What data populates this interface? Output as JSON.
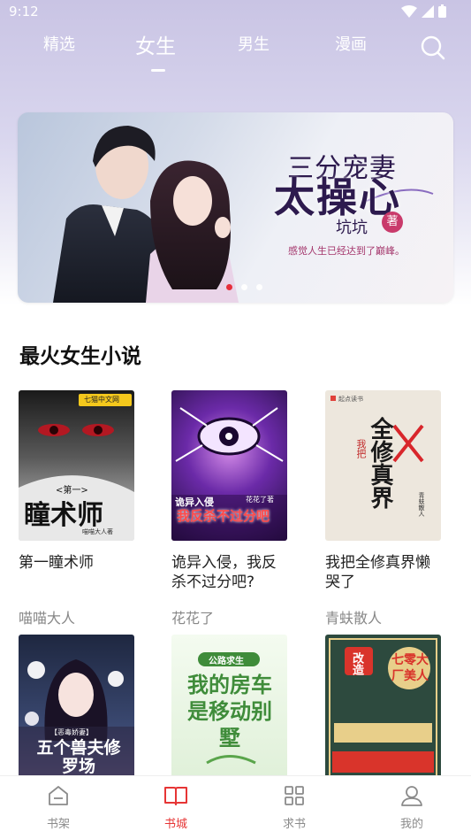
{
  "status_bar": {
    "time": "9:12"
  },
  "tabs": [
    {
      "label": "精选",
      "active": false
    },
    {
      "label": "女生",
      "active": true
    },
    {
      "label": "男生",
      "active": false
    },
    {
      "label": "漫画",
      "active": false
    }
  ],
  "banner": {
    "title_line1": "三分宠妻",
    "title_line2": "太操心",
    "author": "坑坑",
    "author_badge": "著",
    "tagline": "感觉人生已经达到了巅峰。",
    "slide_count": 3,
    "active_slide": 1
  },
  "section": {
    "title": "最火女生小说"
  },
  "books": [
    {
      "title": "第一瞳术师",
      "author": "喵喵大人",
      "cover_text": "瞳术师",
      "cover_sub": "<第一>",
      "cover_author": "喵喵大人著",
      "publisher": "七猫中文网",
      "cover_palette": "#3a3a3a"
    },
    {
      "title": "诡异入侵，我反杀不过分吧?",
      "author": "花花了",
      "cover_text": "我反杀不过分吧",
      "cover_sub": "诡异入侵",
      "cover_author": "花花了著",
      "publisher": "",
      "cover_palette": "#4a1f6e"
    },
    {
      "title": "我把全修真界懒哭了",
      "author": "青蚨散人",
      "cover_text": "全修真界",
      "cover_sub": "我把",
      "cover_author": "青蚨散人",
      "publisher": "起点读书",
      "cover_palette": "#ede7dd"
    },
    {
      "title": "",
      "author": "",
      "cover_text": "五个兽夫修罗场",
      "cover_sub": "【恶毒娇妻】",
      "cover_author": "",
      "publisher": "",
      "cover_palette": "#2f3b5c"
    },
    {
      "title": "",
      "author": "",
      "cover_text": "我的房车是移动别墅",
      "cover_sub": "公路求生",
      "cover_author": "",
      "publisher": "",
      "cover_palette": "#dff0d8"
    },
    {
      "title": "",
      "author": "",
      "cover_text": "七零大厂美人",
      "cover_sub": "改造",
      "cover_author": "",
      "publisher": "",
      "cover_palette": "#2d4a3e"
    }
  ],
  "bottom_nav": [
    {
      "label": "书架",
      "icon": "bookshelf-icon",
      "active": false
    },
    {
      "label": "书城",
      "icon": "book-open-icon",
      "active": true
    },
    {
      "label": "求书",
      "icon": "grid-icon",
      "active": false
    },
    {
      "label": "我的",
      "icon": "user-icon",
      "active": false
    }
  ],
  "colors": {
    "accent": "#e63535",
    "header_bg": "#c9c4e4"
  }
}
